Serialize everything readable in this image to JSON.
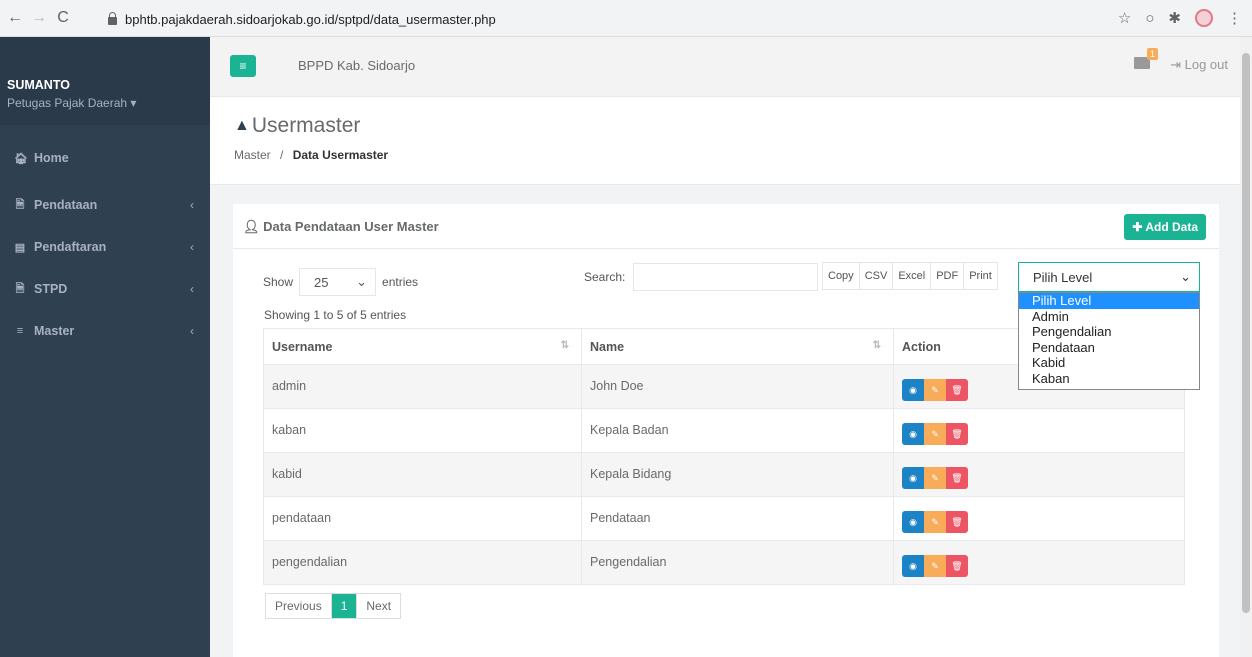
{
  "browser": {
    "url": "bphtb.pajakdaerah.sidoarjokab.go.id/sptpd/data_usermaster.php",
    "back_icon": "←",
    "forward_icon": "→",
    "reload_icon": "C"
  },
  "sidebar": {
    "user_name": "SUMANTO",
    "user_role": "Petugas Pajak Daerah ▾",
    "items": [
      {
        "label": "Home",
        "icon": "home-icon",
        "glyph": "🏠︎"
      },
      {
        "label": "Pendataan",
        "icon": "file-icon",
        "glyph": "🗎"
      },
      {
        "label": "Pendaftaran",
        "icon": "id-card-icon",
        "glyph": "▤"
      },
      {
        "label": "STPD",
        "icon": "file-icon",
        "glyph": "🗎"
      },
      {
        "label": "Master",
        "icon": "database-icon",
        "glyph": "≡"
      }
    ]
  },
  "topbar": {
    "org_name": "BPPD Kab. Sidoarjo",
    "mail_count": "1",
    "logout_label": "Log out"
  },
  "header": {
    "title": "Usermaster",
    "breadcrumb_parent": "Master",
    "breadcrumb_sep": "/",
    "breadcrumb_current": "Data Usermaster"
  },
  "box": {
    "title": "Data Pendataan User Master",
    "add_label": "Add Data"
  },
  "table_controls": {
    "show_label": "Show",
    "entries_value": "25",
    "entries_label": "entries",
    "search_label": "Search:",
    "search_value": "",
    "export_buttons": [
      "Copy",
      "CSV",
      "Excel",
      "PDF",
      "Print"
    ],
    "level_select": "Pilih Level",
    "level_options": [
      "Pilih Level",
      "Admin",
      "Pengendalian",
      "Pendataan",
      "Kabid",
      "Kaban"
    ],
    "info": "Showing 1 to 5 of 5 entries"
  },
  "table": {
    "headers": [
      "Username",
      "Name",
      "Action"
    ],
    "rows": [
      [
        "admin",
        "John Doe"
      ],
      [
        "kaban",
        "Kepala Badan"
      ],
      [
        "kabid",
        "Kepala Bidang"
      ],
      [
        "pendataan",
        "Pendataan"
      ],
      [
        "pengendalian",
        "Pengendalian"
      ]
    ]
  },
  "pager": {
    "previous": "Previous",
    "current": "1",
    "next": "Next"
  }
}
